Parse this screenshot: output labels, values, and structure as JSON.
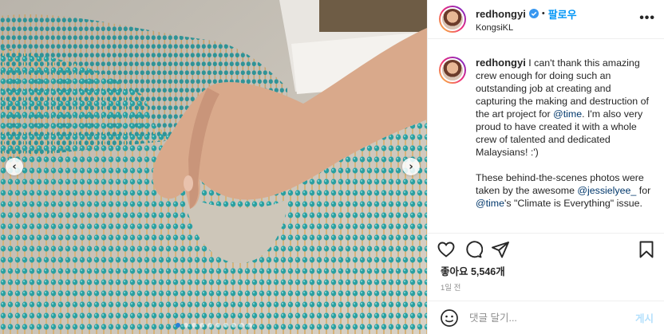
{
  "header": {
    "username": "redhongyi",
    "separator": "•",
    "follow_label": "팔로우",
    "location": "KongsiKL",
    "more_icon": "more-icon",
    "more_label": "•••"
  },
  "caption": {
    "username": "redhongyi",
    "text_a": " I can't thank this amazing crew enough for doing such an outstanding job at creating and capturing the making and destruction of the art project for ",
    "mention_time": "@time",
    "text_b": ". I'm also very proud to have created it with a whole crew of talented and dedicated Malaysians! :')",
    "para2_a": "These behind-the-scenes photos were taken by the awesome ",
    "mention_jessie": "@jessielyee_",
    "para2_b": " for ",
    "mention_time2": "@time",
    "para2_c": "'s \"Climate is Everything\" issue."
  },
  "actions": {
    "like_icon": "heart-icon",
    "comment_icon": "comment-icon",
    "share_icon": "share-icon",
    "save_icon": "bookmark-icon"
  },
  "likes_text": "좋아요 5,546개",
  "time_text": "1일 전",
  "comment": {
    "placeholder": "댓글 달기...",
    "post_label": "게시"
  },
  "carousel": {
    "prev_glyph": "‹",
    "next_glyph": "›",
    "slide_count": 10,
    "active_index": 0
  },
  "colors": {
    "accent": "#0095f6",
    "mention": "#00376b",
    "match_head": "#2aa3a4",
    "post_disabled": "#b2dffc"
  }
}
